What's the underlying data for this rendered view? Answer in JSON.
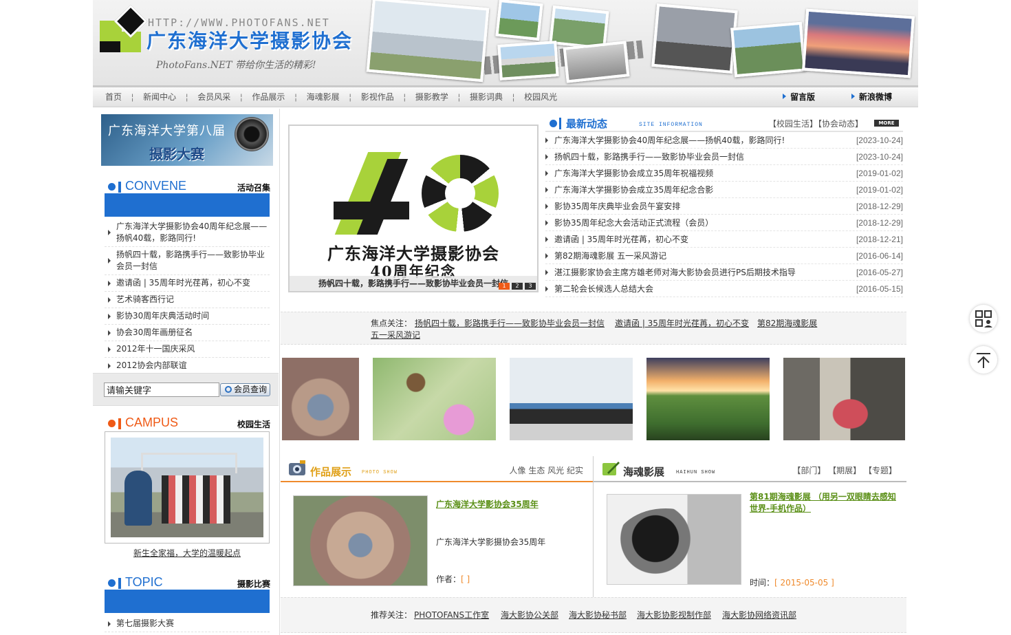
{
  "header": {
    "url_text": "HTTP://WWW.PHOTOFANS.NET",
    "site_title": "广东海洋大学摄影协会",
    "slogan": "PhotoFans.NET 带给你生活的精彩!"
  },
  "nav": {
    "items": [
      "首页",
      "新闻中心",
      "会员风采",
      "作品展示",
      "海魂影展",
      "影视作品",
      "摄影教学",
      "摄影词典",
      "校园风光"
    ],
    "guestbook": "留言版",
    "weibo": "新浪微博"
  },
  "left": {
    "banner": {
      "line1": "广东海洋大学第八届",
      "line2": "摄影大赛"
    },
    "convene": {
      "en": "CONVENE",
      "cn": "活动召集",
      "items": [
        "广东海洋大学摄影协会40周年纪念展——扬帆40载，影路同行!",
        "扬帆四十载，影路携手行——致影协毕业会员一封信",
        "邀请函 | 35周年时光荏苒，初心不变",
        "艺术骑客西行记",
        "影协30周年庆典活动时间",
        "协会30周年画册征名",
        "2012年十一国庆采风",
        "2012协会内部联谊"
      ]
    },
    "search": {
      "placeholder": "请输关键字",
      "button": "会员查询"
    },
    "campus": {
      "en": "CAMPUS",
      "cn": "校园生活",
      "caption": "新生全家福，大学的温暖起点"
    },
    "topic": {
      "en": "TOPIC",
      "cn": "摄影比赛",
      "items": [
        "第七届摄影大赛"
      ]
    }
  },
  "slider": {
    "title_line1": "广东海洋大学摄影协会",
    "title_line2": "40周年纪念",
    "caption": "扬帆四十载，影路携手行——致影协毕业会员一封信",
    "pages": [
      "1",
      "2",
      "3"
    ]
  },
  "news": {
    "title": "最新动态",
    "subtitle": "SITE INFORMATION",
    "cat1": "【校园生活】",
    "cat2": "【协会动态】",
    "more": "MORE",
    "items": [
      {
        "title": "广东海洋大学摄影协会40周年纪念展——扬帆40载，影路同行!",
        "date": "[2023-10-24]"
      },
      {
        "title": "扬帆四十载，影路携手行——致影协毕业会员一封信",
        "date": "[2023-10-24]"
      },
      {
        "title": "广东海洋大学摄影协会成立35周年祝福视频",
        "date": "[2019-01-02]"
      },
      {
        "title": "广东海洋大学摄影协会成立35周年纪念合影",
        "date": "[2019-01-02]"
      },
      {
        "title": "影协35周年庆典毕业会员午宴安排",
        "date": "[2018-12-29]"
      },
      {
        "title": "影协35周年纪念大会活动正式流程（会员）",
        "date": "[2018-12-29]"
      },
      {
        "title": "邀请函 | 35周年时光荏苒，初心不变",
        "date": "[2018-12-21]"
      },
      {
        "title": "第82期海魂影展 五一采风游记",
        "date": "[2016-06-14]"
      },
      {
        "title": "湛江摄影家协会主席方雄老师对海大影协会员进行PS后期技术指导",
        "date": "[2016-05-27]"
      },
      {
        "title": "第二轮会长候选人总结大会",
        "date": "[2016-05-15]"
      }
    ]
  },
  "focus": {
    "label": "焦点关注：",
    "links": [
      "扬帆四十载，影路携手行——致影协毕业会员一封信",
      "邀请函 | 35周年时光荏苒，初心不变",
      "第82期海魂影展",
      "五一采风游记"
    ]
  },
  "works": {
    "title": "作品展示",
    "subtitle": "PHOTO SHOW",
    "tags": "人像 生态 风光 纪实",
    "item_title": "广东海洋大学影协会35周年",
    "item_desc": "广东海洋大学影摄协会35周年",
    "author_label": "作者：",
    "author_value": "[ ]"
  },
  "haihun": {
    "title": "海魂影展",
    "subtitle": "HAIHUN SHOW",
    "tags": "【部门】 【期展】 【专题】",
    "item_title": "第81期海魂影展 （用另一双眼睛去感知世界-手机作品）",
    "time_label": "时间：",
    "time_value": "[ 2015-05-05 ]"
  },
  "recommend": {
    "label": "推荐关注：",
    "links": [
      "PHOTOFANS工作室",
      "海大影协公关部",
      "海大影协秘书部",
      "海大影协影视制作部",
      "海大影协网络资讯部"
    ]
  },
  "colors": {
    "brand_blue": "#1f6fd0",
    "accent_green": "#a8d23a",
    "accent_orange": "#ef5a16"
  }
}
